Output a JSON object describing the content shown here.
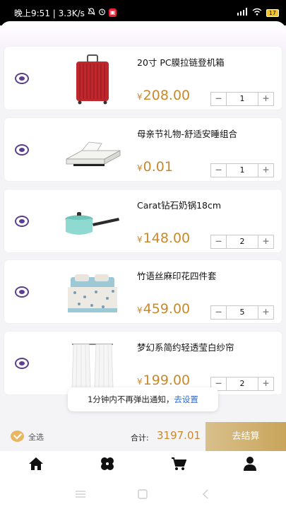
{
  "status_bar": {
    "time_text": "晚上9:51 | 3.3K/s",
    "battery": "17"
  },
  "products": [
    {
      "title": "20寸 PC膜拉链登机箱",
      "currency": "¥",
      "price": "208.00",
      "qty": "1",
      "icon": "luggage-icon"
    },
    {
      "title": "母亲节礼物-舒适安睡组合",
      "currency": "¥",
      "price": "0.01",
      "qty": "1",
      "icon": "bedding-icon"
    },
    {
      "title": "Carat钻石奶锅18cm",
      "currency": "¥",
      "price": "148.00",
      "qty": "2",
      "icon": "saucepan-icon"
    },
    {
      "title": "竹语丝麻印花四件套",
      "currency": "¥",
      "price": "459.00",
      "qty": "5",
      "icon": "bedsheet-set-icon"
    },
    {
      "title": "梦幻系简约轻透莹白纱帘",
      "currency": "¥",
      "price": "199.00",
      "qty": "2",
      "icon": "curtain-icon"
    }
  ],
  "stepper": {
    "minus": "−",
    "plus": "+"
  },
  "toast": {
    "text": "1分钟内不再弹出通知，",
    "link": "去设置"
  },
  "checkout": {
    "select_all": "全选",
    "total_label": "合计:",
    "total_value": "3197.01",
    "button": "去结算"
  },
  "tabbar": [
    "home-icon",
    "category-icon",
    "cart-icon",
    "profile-icon"
  ],
  "colors": {
    "accent_purple": "#5b3e8e",
    "price_gold": "#c8892c",
    "button_gold": "#c9a55c"
  }
}
